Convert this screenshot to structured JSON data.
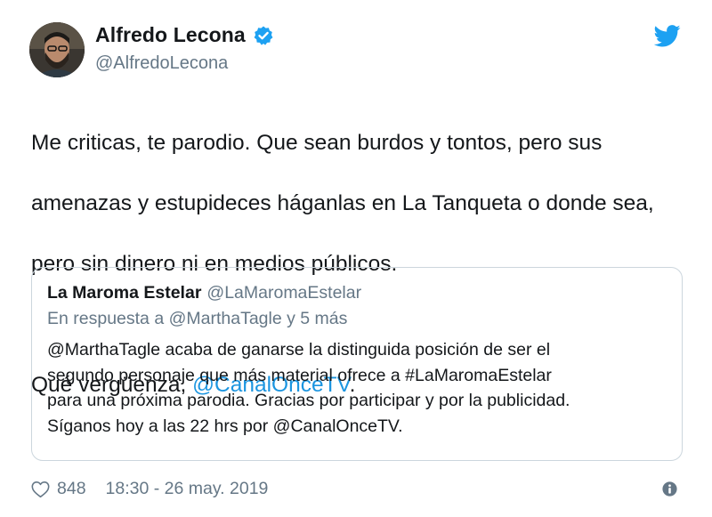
{
  "author": {
    "display_name": "Alfredo Lecona",
    "handle": "@AlfredoLecona",
    "verified": true,
    "avatar_icon": "profile-photo",
    "brand_icon": "twitter-bird-icon"
  },
  "tweet": {
    "line1": "Me criticas, te parodio. Que sean burdos y tontos, pero sus",
    "line2": "amenazas y estupideces háganlas en La Tanqueta o donde sea,",
    "line3": "pero sin dinero ni en medios públicos.",
    "line4_prefix": "Qué vergüenza, ",
    "line4_mention": "@CanalOnceTV",
    "line4_suffix": "."
  },
  "quote": {
    "display_name": "La Maroma Estelar",
    "handle": "@LaMaromaEstelar",
    "reply_context": "En respuesta a @MarthaTagle y 5 más",
    "lines": [
      "@MarthaTagle acaba de ganarse la distinguida posición de ser el",
      "segundo personaje que más material ofrece a #LaMaromaEstelar",
      "para una próxima parodia. Gracias por participar y por la publicidad.",
      "Síganos hoy a las 22 hrs por @CanalOnceTV."
    ]
  },
  "footer": {
    "likes": "848",
    "timestamp": "18:30 - 26 may. 2019"
  },
  "colors": {
    "text": "#14171a",
    "secondary": "#657786",
    "link": "#1b95e0",
    "verified": "#1da1f2",
    "border": "#ccd6dd"
  }
}
